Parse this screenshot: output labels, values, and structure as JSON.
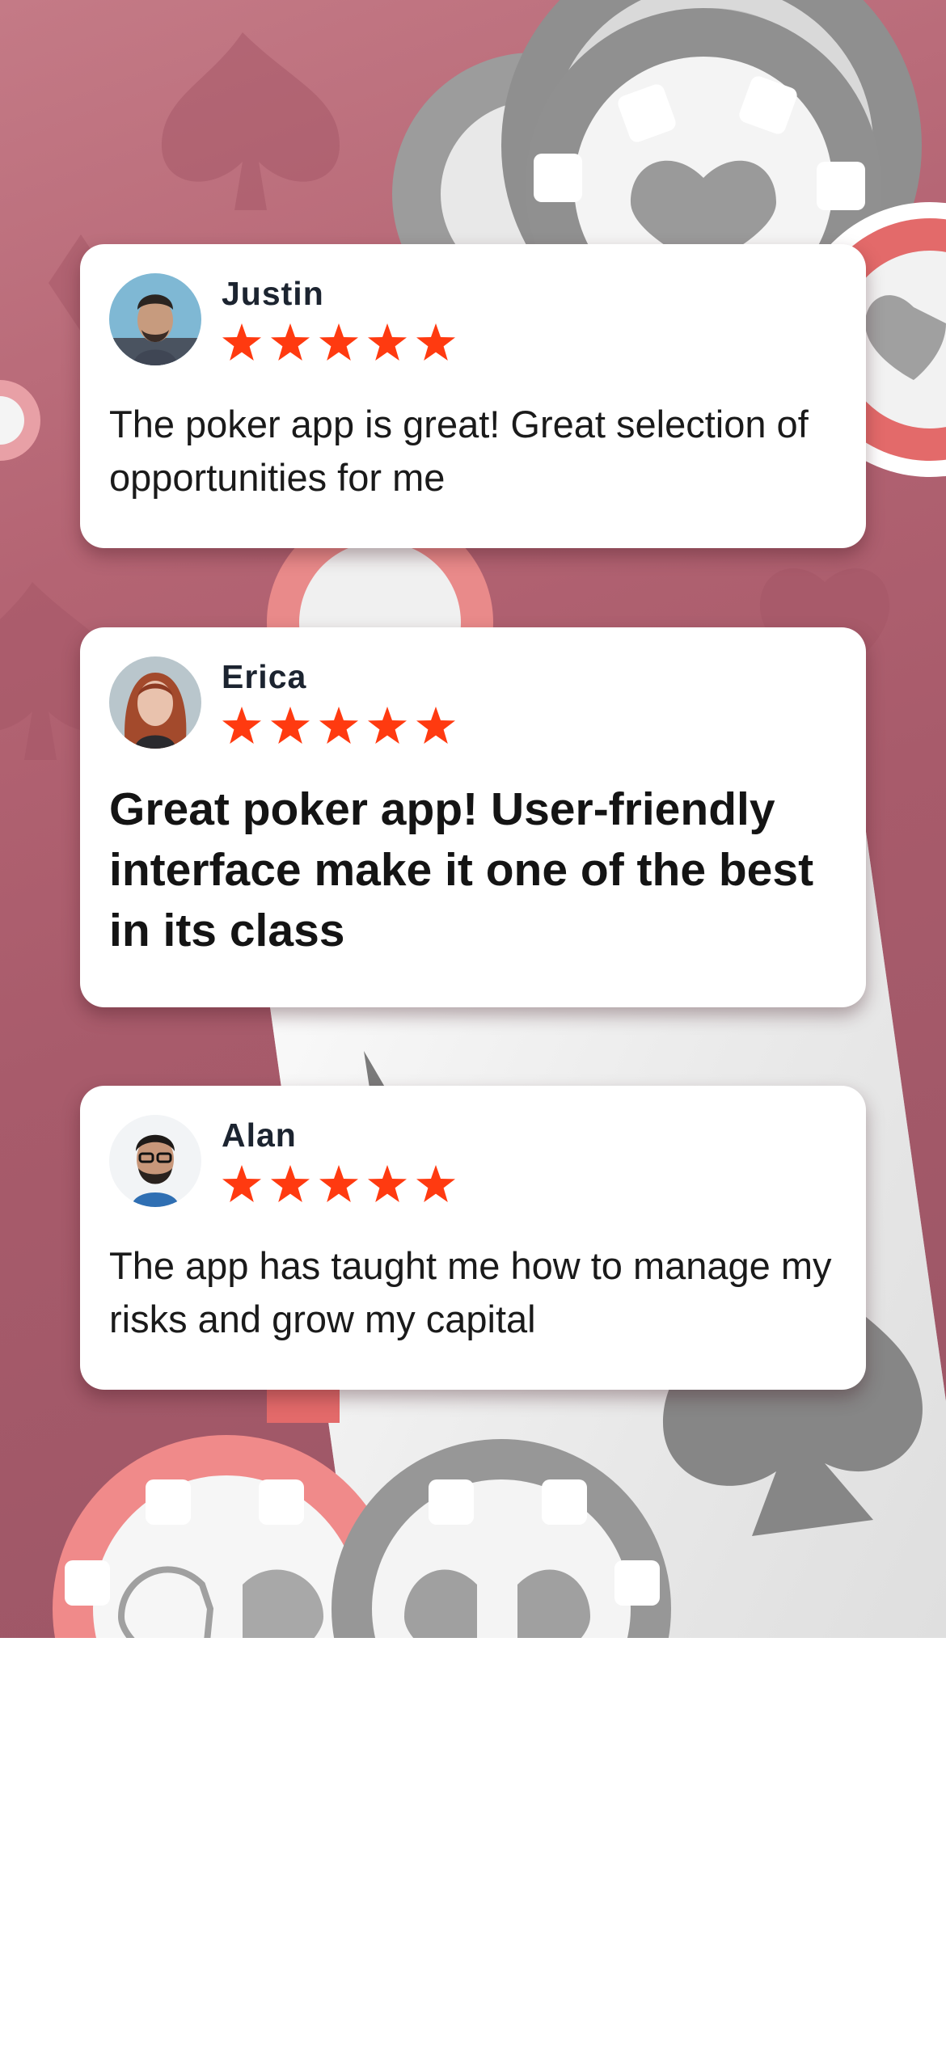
{
  "colors": {
    "star": "#ff3a10",
    "card_bg": "#ffffff",
    "name_text": "#1c2430",
    "background_top": "#c47a86",
    "background_bottom": "#9a5565"
  },
  "reviews": [
    {
      "name": "Justin",
      "rating": 5,
      "text": "The poker app is great! Great selection of opportunities for me",
      "emphasis": false
    },
    {
      "name": "Erica",
      "rating": 5,
      "text": "Great poker app! User-friendly interface make it one of the best in its class",
      "emphasis": true
    },
    {
      "name": "Alan",
      "rating": 5,
      "text": "The app has taught me how to manage  my risks and grow my capital",
      "emphasis": false
    }
  ]
}
